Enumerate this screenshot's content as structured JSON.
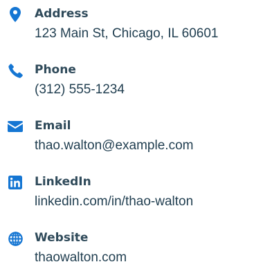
{
  "accent_color": "#1576d3",
  "contacts": [
    {
      "icon": "map-pin-icon",
      "label": "Address",
      "value": "123 Main St, Chicago, IL 60601"
    },
    {
      "icon": "phone-icon",
      "label": "Phone",
      "value": "(312) 555-1234"
    },
    {
      "icon": "envelope-icon",
      "label": "Email",
      "value": "thao.walton@example.com"
    },
    {
      "icon": "linkedin-icon",
      "label": "LinkedIn",
      "value": "linkedin.com/in/thao-walton"
    },
    {
      "icon": "globe-icon",
      "label": "Website",
      "value": "thaowalton.com"
    }
  ]
}
